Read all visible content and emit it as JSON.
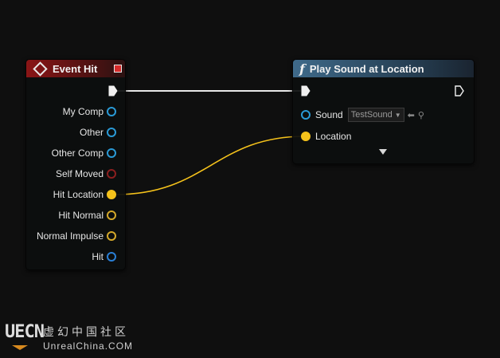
{
  "graph": {
    "event_node": {
      "title": "Event Hit",
      "outputs": [
        {
          "label": "My Comp",
          "color": "#2a9ad6",
          "filled": false
        },
        {
          "label": "Other",
          "color": "#2a9ad6",
          "filled": false
        },
        {
          "label": "Other Comp",
          "color": "#2a9ad6",
          "filled": false
        },
        {
          "label": "Self Moved",
          "color": "#8b1f1f",
          "filled": false
        },
        {
          "label": "Hit Location",
          "color": "#f5c21b",
          "filled": true
        },
        {
          "label": "Hit Normal",
          "color": "#d4a82a",
          "filled": false
        },
        {
          "label": "Normal Impulse",
          "color": "#d4a82a",
          "filled": false
        },
        {
          "label": "Hit",
          "color": "#2a7fd6",
          "filled": false
        }
      ],
      "header_color": "#8a1516"
    },
    "function_node": {
      "icon": "function-icon",
      "icon_glyph": "f",
      "title": "Play Sound at Location",
      "sound_label": "Sound",
      "sound_value": "TestSound",
      "location_label": "Location",
      "header_color": "#3f6a8a"
    },
    "connections": [
      {
        "from": "Event Hit exec",
        "to": "Play Sound at Location exec",
        "color": "#e8e8e8"
      },
      {
        "from": "Hit Location",
        "to": "Location",
        "color": "#f5c21b"
      }
    ]
  },
  "watermark": {
    "logo": "UECN",
    "site_cn": "虚幻中国社区",
    "site_en": "UnrealChina.COM"
  }
}
